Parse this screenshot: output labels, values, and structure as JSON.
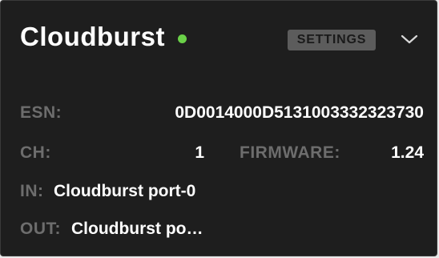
{
  "header": {
    "title": "Cloudburst",
    "status_color": "#6ad148",
    "status_icon": "status-dot-icon",
    "settings_label": "SETTINGS",
    "expand_icon": "chevron-down-icon"
  },
  "details": {
    "esn_label": "ESN:",
    "esn_value": "0D0014000D5131003332323730",
    "ch_label": "CH:",
    "ch_value": "1",
    "firmware_label": "FIRMWARE:",
    "firmware_value": "1.24",
    "in_label": "IN:",
    "in_value": "Cloudburst port-0",
    "out_label": "OUT:",
    "out_value": "Cloudburst po…"
  }
}
